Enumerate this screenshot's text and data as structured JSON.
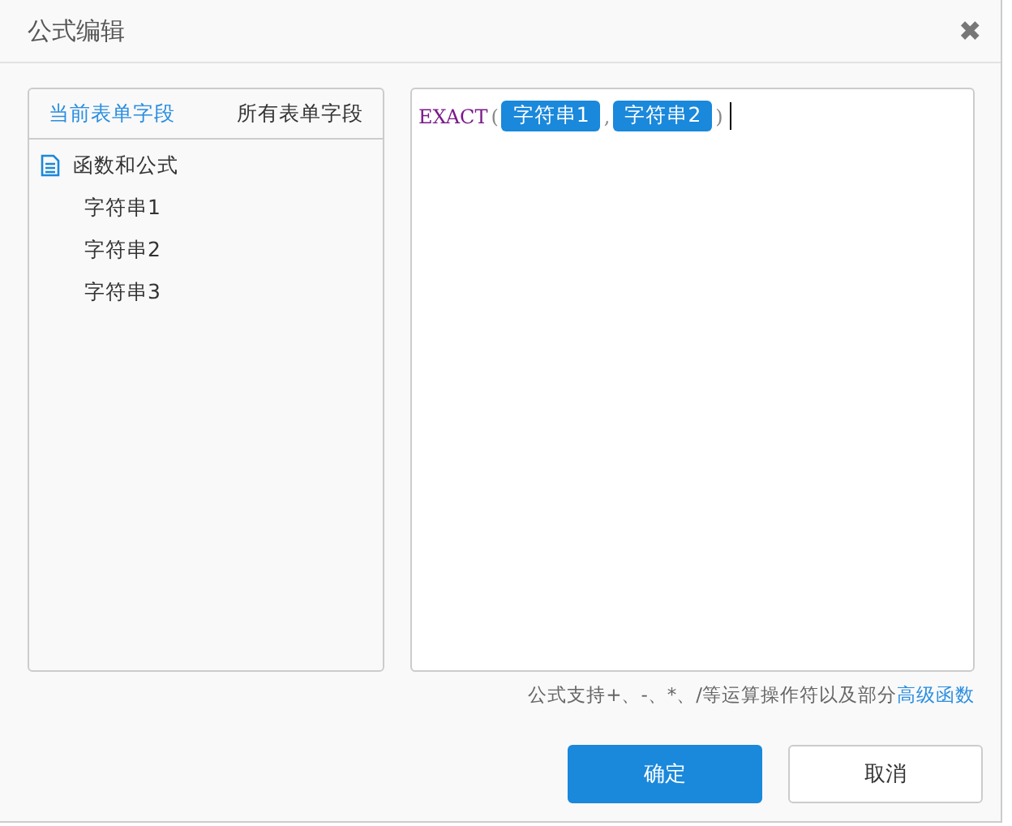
{
  "dialog": {
    "title": "公式编辑",
    "close": "✖"
  },
  "tabs": [
    {
      "label": "当前表单字段",
      "selected": true
    },
    {
      "label": "所有表单字段",
      "selected": false
    }
  ],
  "tree": [
    {
      "label": "函数和公式",
      "children": [
        {
          "label": "字符串1"
        },
        {
          "label": "字符串2"
        },
        {
          "label": "字符串3"
        }
      ]
    }
  ],
  "formula": [
    {
      "kind": "function",
      "text": "EXACT"
    },
    {
      "kind": "punct",
      "text": "("
    },
    {
      "kind": "field",
      "text": "字符串1"
    },
    {
      "kind": "punct",
      "text": ","
    },
    {
      "kind": "field",
      "text": "字符串2"
    },
    {
      "kind": "punct",
      "text": ")"
    }
  ],
  "hint": {
    "text": "公式支持+、-、*、/等运算操作符以及部分",
    "link": "高级函数"
  },
  "buttons": [
    {
      "label": "确定",
      "kind": "primary"
    },
    {
      "label": "取消",
      "kind": "default"
    }
  ]
}
